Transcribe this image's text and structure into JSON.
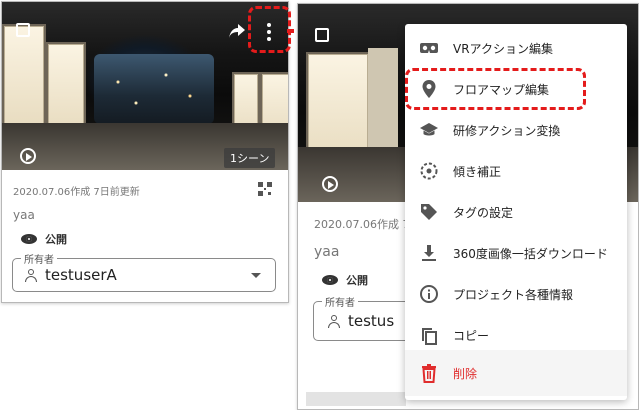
{
  "card": {
    "scene_badge": "1シーン",
    "meta": "2020.07.06作成 7日前更新",
    "name": "yaa",
    "visibility": "公開",
    "owner_legend": "所有者",
    "owner_value": "testuserA",
    "owner_value_clipped": "testus"
  },
  "menu": {
    "items": [
      {
        "label": "VRアクション編集",
        "icon": "vr-headset-icon"
      },
      {
        "label": "フロアマップ編集",
        "icon": "location-pin-icon"
      },
      {
        "label": "研修アクション変換",
        "icon": "graduation-cap-icon"
      },
      {
        "label": "傾き補正",
        "icon": "crosshair-icon"
      },
      {
        "label": "タグの設定",
        "icon": "tag-icon"
      },
      {
        "label": "360度画像一括ダウンロード",
        "icon": "download-icon"
      },
      {
        "label": "プロジェクト各種情報",
        "icon": "info-icon"
      },
      {
        "label": "コピー",
        "icon": "copy-icon"
      },
      {
        "label": "削除",
        "icon": "trash-icon"
      }
    ]
  },
  "colors": {
    "highlight": "#e41b1b",
    "delete": "#e02d2d",
    "icon": "#555555"
  }
}
